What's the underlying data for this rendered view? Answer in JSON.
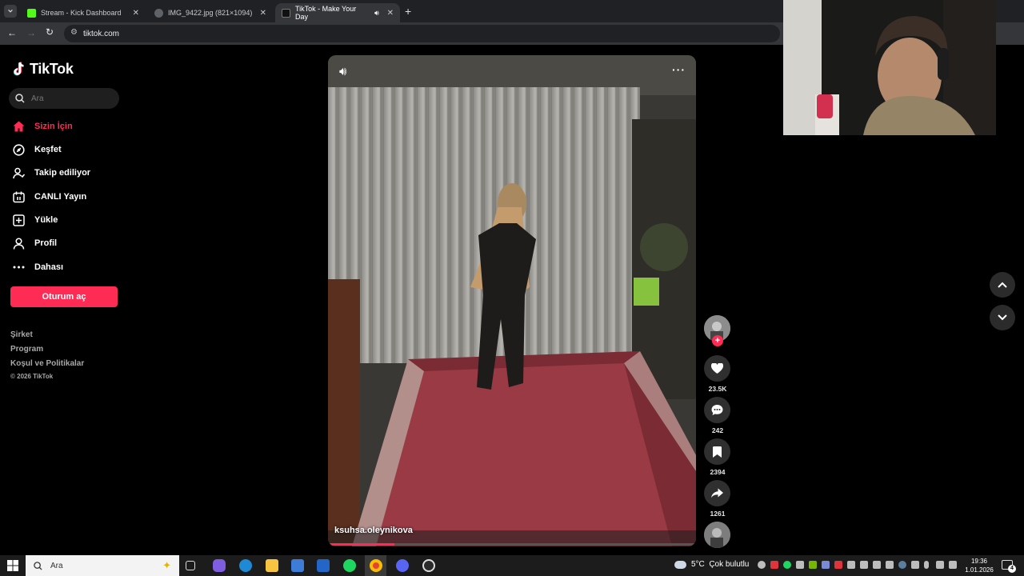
{
  "browser": {
    "tabs": [
      {
        "title": "Stream - Kick Dashboard",
        "favicon_color": "#53fc18"
      },
      {
        "title": "IMG_9422.jpg (821×1094)",
        "favicon_color": "#9aa0a6"
      },
      {
        "title": "TikTok - Make Your Day",
        "favicon_color": "#000000",
        "audio_icon": "speaker-icon",
        "active": true
      }
    ],
    "url": "tiktok.com"
  },
  "sidebar": {
    "logo": "TikTok",
    "search_placeholder": "Ara",
    "nav": [
      {
        "label": "Sizin İçin",
        "icon": "home-icon",
        "active": true
      },
      {
        "label": "Keşfet",
        "icon": "compass-icon"
      },
      {
        "label": "Takip ediliyor",
        "icon": "user-follow-icon"
      },
      {
        "label": "CANLI Yayın",
        "icon": "live-icon"
      },
      {
        "label": "Yükle",
        "icon": "upload-icon"
      },
      {
        "label": "Profil",
        "icon": "profile-icon"
      },
      {
        "label": "Dahası",
        "icon": "more-icon"
      }
    ],
    "login_button": "Oturum aç",
    "footer": [
      "Şirket",
      "Program",
      "Koşul ve Politikalar",
      "© 2026 TikTok"
    ]
  },
  "video": {
    "author": "ksuhsa.oleynikova",
    "progress": 0.18,
    "likes": "23.5K",
    "comments": "242",
    "bookmarks": "2394",
    "shares": "1261"
  },
  "taskbar": {
    "search_placeholder": "Ara",
    "weather": "5°C  Çok bulutlu",
    "time": "19:36",
    "date": "1.01.2026",
    "notification_count": "4"
  },
  "colors": {
    "accent": "#fe2c55",
    "page_bg": "#000000"
  }
}
